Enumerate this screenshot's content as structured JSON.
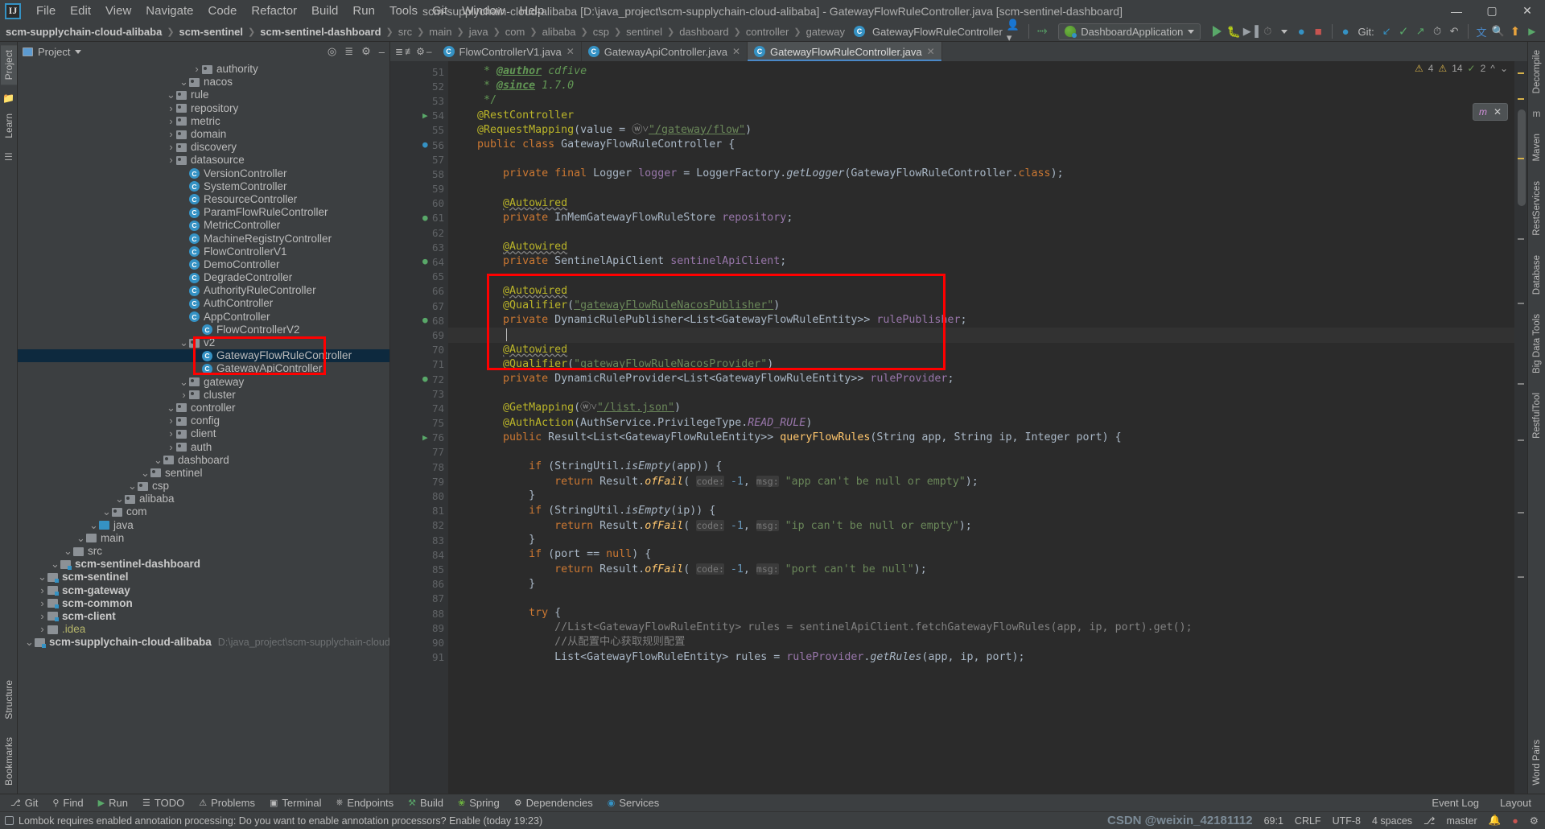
{
  "window": {
    "title": "scm-supplychain-cloud-alibaba [D:\\java_project\\scm-supplychain-cloud-alibaba] - GatewayFlowRuleController.java [scm-sentinel-dashboard]",
    "minimize": "—",
    "maximize": "▢",
    "close": "✕"
  },
  "menu": [
    "File",
    "Edit",
    "View",
    "Navigate",
    "Code",
    "Refactor",
    "Build",
    "Run",
    "Tools",
    "Git",
    "Window",
    "Help"
  ],
  "navbar": {
    "crumbs": [
      {
        "label": "scm-supplychain-cloud-alibaba",
        "style": "bold"
      },
      {
        "label": "scm-sentinel",
        "style": "bold"
      },
      {
        "label": "scm-sentinel-dashboard",
        "style": "bold"
      },
      {
        "label": "src",
        "style": "dim"
      },
      {
        "label": "main",
        "style": "dim"
      },
      {
        "label": "java",
        "style": "dim"
      },
      {
        "label": "com",
        "style": "dim"
      },
      {
        "label": "alibaba",
        "style": "dim"
      },
      {
        "label": "csp",
        "style": "dim"
      },
      {
        "label": "sentinel",
        "style": "dim"
      },
      {
        "label": "dashboard",
        "style": "dim"
      },
      {
        "label": "controller",
        "style": "dim"
      },
      {
        "label": "gateway",
        "style": "dim"
      }
    ],
    "current_class": "GatewayFlowRuleController",
    "run_config": "DashboardApplication",
    "git_label": "Git:"
  },
  "project_panel": {
    "title": "Project",
    "tree": [
      {
        "depth": 0,
        "arrow": "▾",
        "icon": "module",
        "label": "scm-supplychain-cloud-alibaba",
        "bold": true,
        "path": "D:\\java_project\\scm-supplychain-cloud-alibaba"
      },
      {
        "depth": 1,
        "arrow": "▸",
        "icon": "folder-yellow",
        "label": ".idea",
        "yellow": true
      },
      {
        "depth": 1,
        "arrow": "▸",
        "icon": "module",
        "label": "scm-client",
        "bold": true
      },
      {
        "depth": 1,
        "arrow": "▸",
        "icon": "module",
        "label": "scm-common",
        "bold": true
      },
      {
        "depth": 1,
        "arrow": "▸",
        "icon": "module",
        "label": "scm-gateway",
        "bold": true
      },
      {
        "depth": 1,
        "arrow": "▾",
        "icon": "module",
        "label": "scm-sentinel",
        "bold": true
      },
      {
        "depth": 2,
        "arrow": "▾",
        "icon": "module",
        "label": "scm-sentinel-dashboard",
        "bold": true
      },
      {
        "depth": 3,
        "arrow": "▾",
        "icon": "folder",
        "label": "src"
      },
      {
        "depth": 4,
        "arrow": "▾",
        "icon": "folder",
        "label": "main"
      },
      {
        "depth": 5,
        "arrow": "▾",
        "icon": "source-root",
        "label": "java"
      },
      {
        "depth": 6,
        "arrow": "▾",
        "icon": "package",
        "label": "com"
      },
      {
        "depth": 7,
        "arrow": "▾",
        "icon": "package",
        "label": "alibaba"
      },
      {
        "depth": 8,
        "arrow": "▾",
        "icon": "package",
        "label": "csp"
      },
      {
        "depth": 9,
        "arrow": "▾",
        "icon": "package",
        "label": "sentinel"
      },
      {
        "depth": 10,
        "arrow": "▾",
        "icon": "package",
        "label": "dashboard"
      },
      {
        "depth": 11,
        "arrow": "▸",
        "icon": "package",
        "label": "auth"
      },
      {
        "depth": 11,
        "arrow": "▸",
        "icon": "package",
        "label": "client"
      },
      {
        "depth": 11,
        "arrow": "▸",
        "icon": "package",
        "label": "config"
      },
      {
        "depth": 11,
        "arrow": "▾",
        "icon": "package",
        "label": "controller"
      },
      {
        "depth": 12,
        "arrow": "▸",
        "icon": "package",
        "label": "cluster"
      },
      {
        "depth": 12,
        "arrow": "▾",
        "icon": "package",
        "label": "gateway"
      },
      {
        "depth": 13,
        "arrow": "",
        "icon": "class",
        "label": "GatewayApiController"
      },
      {
        "depth": 13,
        "arrow": "",
        "icon": "class",
        "label": "GatewayFlowRuleController",
        "selected": true
      },
      {
        "depth": 12,
        "arrow": "▾",
        "icon": "package",
        "label": "v2"
      },
      {
        "depth": 13,
        "arrow": "",
        "icon": "class",
        "label": "FlowControllerV2"
      },
      {
        "depth": 12,
        "arrow": "",
        "icon": "class",
        "label": "AppController"
      },
      {
        "depth": 12,
        "arrow": "",
        "icon": "class",
        "label": "AuthController"
      },
      {
        "depth": 12,
        "arrow": "",
        "icon": "class",
        "label": "AuthorityRuleController"
      },
      {
        "depth": 12,
        "arrow": "",
        "icon": "class",
        "label": "DegradeController"
      },
      {
        "depth": 12,
        "arrow": "",
        "icon": "class",
        "label": "DemoController"
      },
      {
        "depth": 12,
        "arrow": "",
        "icon": "class",
        "label": "FlowControllerV1"
      },
      {
        "depth": 12,
        "arrow": "",
        "icon": "class",
        "label": "MachineRegistryController"
      },
      {
        "depth": 12,
        "arrow": "",
        "icon": "class",
        "label": "MetricController"
      },
      {
        "depth": 12,
        "arrow": "",
        "icon": "class",
        "label": "ParamFlowRuleController"
      },
      {
        "depth": 12,
        "arrow": "",
        "icon": "class",
        "label": "ResourceController"
      },
      {
        "depth": 12,
        "arrow": "",
        "icon": "class",
        "label": "SystemController"
      },
      {
        "depth": 12,
        "arrow": "",
        "icon": "class",
        "label": "VersionController"
      },
      {
        "depth": 11,
        "arrow": "▸",
        "icon": "package",
        "label": "datasource"
      },
      {
        "depth": 11,
        "arrow": "▸",
        "icon": "package",
        "label": "discovery"
      },
      {
        "depth": 11,
        "arrow": "▸",
        "icon": "package",
        "label": "domain"
      },
      {
        "depth": 11,
        "arrow": "▸",
        "icon": "package",
        "label": "metric"
      },
      {
        "depth": 11,
        "arrow": "▸",
        "icon": "package",
        "label": "repository"
      },
      {
        "depth": 11,
        "arrow": "▾",
        "icon": "package",
        "label": "rule"
      },
      {
        "depth": 12,
        "arrow": "▾",
        "icon": "package",
        "label": "nacos"
      },
      {
        "depth": 13,
        "arrow": "▸",
        "icon": "package",
        "label": "authority"
      }
    ]
  },
  "editor": {
    "tabs": [
      {
        "label": "FlowControllerV1.java",
        "active": false
      },
      {
        "label": "GatewayApiController.java",
        "active": false
      },
      {
        "label": "GatewayFlowRuleController.java",
        "active": true
      }
    ],
    "inspection": {
      "warnings": "4",
      "weak_warnings": "14",
      "typos": "2"
    },
    "first_line_number": 51,
    "lines": [
      {
        "n": 51,
        "text": "     * @author cdfive"
      },
      {
        "n": 52,
        "text": "     * @since 1.7.0"
      },
      {
        "n": 53,
        "text": "     */"
      },
      {
        "n": 54,
        "text": "    @RestController"
      },
      {
        "n": 55,
        "text": "    @RequestMapping(value = \"/gateway/flow\")"
      },
      {
        "n": 56,
        "text": "    public class GatewayFlowRuleController {"
      },
      {
        "n": 57,
        "text": ""
      },
      {
        "n": 58,
        "text": "        private final Logger logger = LoggerFactory.getLogger(GatewayFlowRuleController.class);"
      },
      {
        "n": 59,
        "text": ""
      },
      {
        "n": 60,
        "text": "        @Autowired"
      },
      {
        "n": 61,
        "text": "        private InMemGatewayFlowRuleStore repository;"
      },
      {
        "n": 62,
        "text": ""
      },
      {
        "n": 63,
        "text": "        @Autowired"
      },
      {
        "n": 64,
        "text": "        private SentinelApiClient sentinelApiClient;"
      },
      {
        "n": 65,
        "text": ""
      },
      {
        "n": 66,
        "text": "        @Autowired"
      },
      {
        "n": 67,
        "text": "        @Qualifier(\"gatewayFlowRuleNacosPublisher\")"
      },
      {
        "n": 68,
        "text": "        private DynamicRulePublisher<List<GatewayFlowRuleEntity>> rulePublisher;"
      },
      {
        "n": 69,
        "text": ""
      },
      {
        "n": 70,
        "text": "        @Autowired"
      },
      {
        "n": 71,
        "text": "        @Qualifier(\"gatewayFlowRuleNacosProvider\")"
      },
      {
        "n": 72,
        "text": "        private DynamicRuleProvider<List<GatewayFlowRuleEntity>> ruleProvider;"
      },
      {
        "n": 73,
        "text": ""
      },
      {
        "n": 74,
        "text": "        @GetMapping(\"/list.json\")"
      },
      {
        "n": 75,
        "text": "        @AuthAction(AuthService.PrivilegeType.READ_RULE)"
      },
      {
        "n": 76,
        "text": "        public Result<List<GatewayFlowRuleEntity>> queryFlowRules(String app, String ip, Integer port) {"
      },
      {
        "n": 77,
        "text": ""
      },
      {
        "n": 78,
        "text": "            if (StringUtil.isEmpty(app)) {"
      },
      {
        "n": 79,
        "text": "                return Result.ofFail( code: -1, msg: \"app can't be null or empty\");"
      },
      {
        "n": 80,
        "text": "            }"
      },
      {
        "n": 81,
        "text": "            if (StringUtil.isEmpty(ip)) {"
      },
      {
        "n": 82,
        "text": "                return Result.ofFail( code: -1, msg: \"ip can't be null or empty\");"
      },
      {
        "n": 83,
        "text": "            }"
      },
      {
        "n": 84,
        "text": "            if (port == null) {"
      },
      {
        "n": 85,
        "text": "                return Result.ofFail( code: -1, msg: \"port can't be null\");"
      },
      {
        "n": 86,
        "text": "            }"
      },
      {
        "n": 87,
        "text": ""
      },
      {
        "n": 88,
        "text": "            try {"
      },
      {
        "n": 89,
        "text": "                //List<GatewayFlowRuleEntity> rules = sentinelApiClient.fetchGatewayFlowRules(app, ip, port).get();"
      },
      {
        "n": 90,
        "text": "                //从配置中心获取规则配置"
      },
      {
        "n": 91,
        "text": "                List<GatewayFlowRuleEntity> rules = ruleProvider.getRules(app, ip, port);"
      }
    ]
  },
  "bottom_tools": [
    {
      "label": "Git",
      "icon": "git-icon"
    },
    {
      "label": "Find",
      "icon": "find-icon"
    },
    {
      "label": "Run",
      "icon": "run-icon"
    },
    {
      "label": "TODO",
      "icon": "todo-icon"
    },
    {
      "label": "Problems",
      "icon": "problems-icon"
    },
    {
      "label": "Terminal",
      "icon": "terminal-icon"
    },
    {
      "label": "Endpoints",
      "icon": "endpoints-icon"
    },
    {
      "label": "Build",
      "icon": "build-icon"
    },
    {
      "label": "Spring",
      "icon": "spring-icon"
    },
    {
      "label": "Dependencies",
      "icon": "dependencies-icon"
    },
    {
      "label": "Services",
      "icon": "services-icon"
    }
  ],
  "bottom_right": {
    "event_log": "Event Log",
    "layout": "Layout"
  },
  "statusbar": {
    "message": "Lombok requires enabled annotation processing: Do you want to enable annotation processors? Enable (today 19:23)",
    "caret": "69:1",
    "line_sep": "CRLF",
    "encoding": "UTF-8",
    "indent": "4 spaces",
    "branch": "master",
    "watermark": "CSDN @weixin_42181112"
  }
}
